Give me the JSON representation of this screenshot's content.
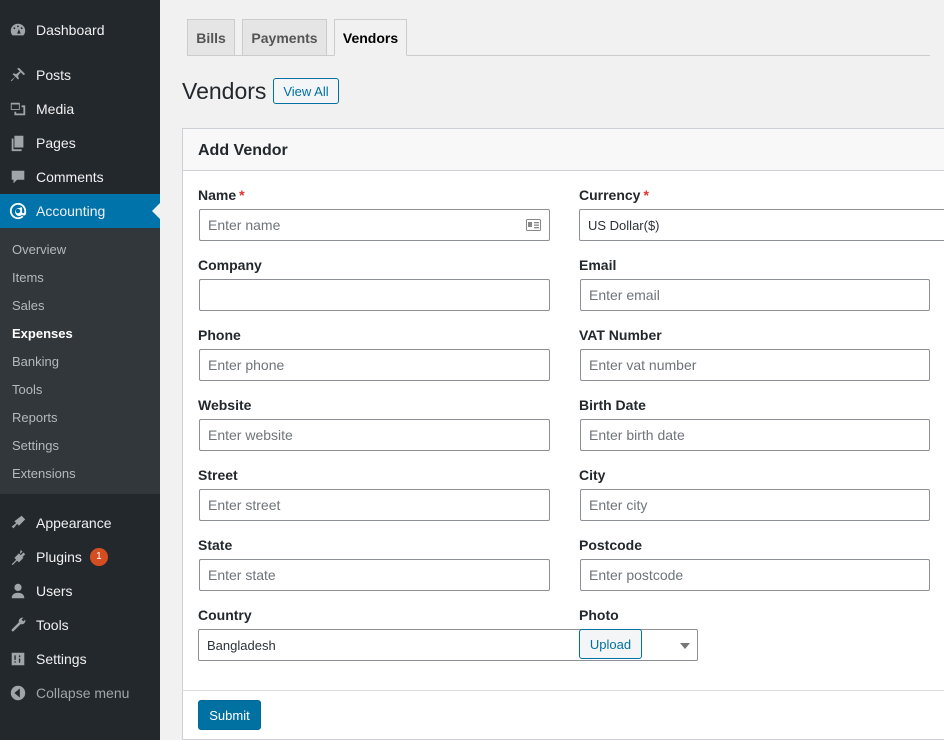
{
  "sidebar": {
    "top_items": [
      {
        "label": "Dashboard",
        "icon": "dashboard-icon"
      },
      {
        "label": "Posts",
        "icon": "pin-icon"
      },
      {
        "label": "Media",
        "icon": "media-icon"
      },
      {
        "label": "Pages",
        "icon": "pages-icon"
      },
      {
        "label": "Comments",
        "icon": "comment-icon"
      },
      {
        "label": "Accounting",
        "icon": "accounting-icon"
      }
    ],
    "submenu": [
      "Overview",
      "Items",
      "Sales",
      "Expenses",
      "Banking",
      "Tools",
      "Reports",
      "Settings",
      "Extensions"
    ],
    "current_submenu": "Expenses",
    "bottom_items": [
      {
        "label": "Appearance",
        "icon": "brush-icon"
      },
      {
        "label": "Plugins",
        "icon": "plugin-icon",
        "badge": "1"
      },
      {
        "label": "Users",
        "icon": "user-icon"
      },
      {
        "label": "Tools",
        "icon": "wrench-icon"
      },
      {
        "label": "Settings",
        "icon": "sliders-icon"
      }
    ],
    "collapse_label": "Collapse menu"
  },
  "tabs": [
    "Bills",
    "Payments",
    "Vendors"
  ],
  "active_tab": "Vendors",
  "page": {
    "title": "Vendors",
    "view_all_label": "View All"
  },
  "form": {
    "title": "Add Vendor",
    "required_mark": "*",
    "name": {
      "label": "Name",
      "placeholder": "Enter name"
    },
    "currency": {
      "label": "Currency",
      "value": "US Dollar($)"
    },
    "company": {
      "label": "Company",
      "placeholder": ""
    },
    "email": {
      "label": "Email",
      "placeholder": "Enter email"
    },
    "phone": {
      "label": "Phone",
      "placeholder": "Enter phone"
    },
    "vat": {
      "label": "VAT Number",
      "placeholder": "Enter vat number"
    },
    "website": {
      "label": "Website",
      "placeholder": "Enter website"
    },
    "birth_date": {
      "label": "Birth Date",
      "placeholder": "Enter birth date"
    },
    "street": {
      "label": "Street",
      "placeholder": "Enter street"
    },
    "city": {
      "label": "City",
      "placeholder": "Enter city"
    },
    "state": {
      "label": "State",
      "placeholder": "Enter state"
    },
    "postcode": {
      "label": "Postcode",
      "placeholder": "Enter postcode"
    },
    "country": {
      "label": "Country",
      "value": "Bangladesh"
    },
    "photo": {
      "label": "Photo",
      "upload_label": "Upload"
    },
    "submit_label": "Submit"
  },
  "colors": {
    "sidebar_bg": "#23282d",
    "submenu_bg": "#32373c",
    "accent": "#0073aa",
    "badge": "#d54e21",
    "required": "#dc3232"
  }
}
